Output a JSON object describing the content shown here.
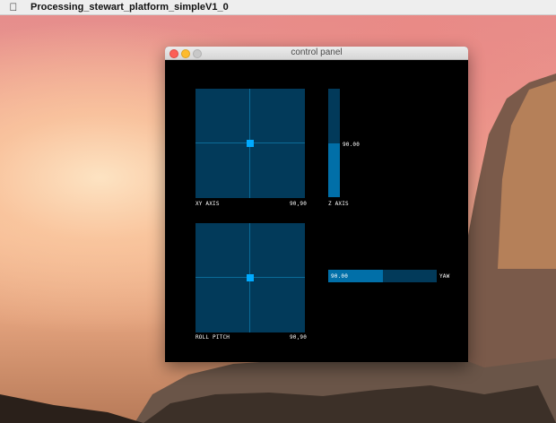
{
  "menubar": {
    "app_name": "Processing_stewart_platform_simpleV1_0"
  },
  "window": {
    "title": "control panel"
  },
  "controls": {
    "xy_pad": {
      "label": "XY AXIS",
      "value": "90,90"
    },
    "z_slider": {
      "label": "Z AXIS",
      "value": "90.00",
      "level": 0.5
    },
    "roll_pitch_pad": {
      "label": "ROLL PITCH",
      "value": "90,90"
    },
    "yaw_slider": {
      "label": "YAW",
      "value": "90.00",
      "level": 0.5
    }
  },
  "colors": {
    "slider_bg": "#023a5a",
    "slider_fill": "#016fa8",
    "handle": "#00aaff"
  }
}
